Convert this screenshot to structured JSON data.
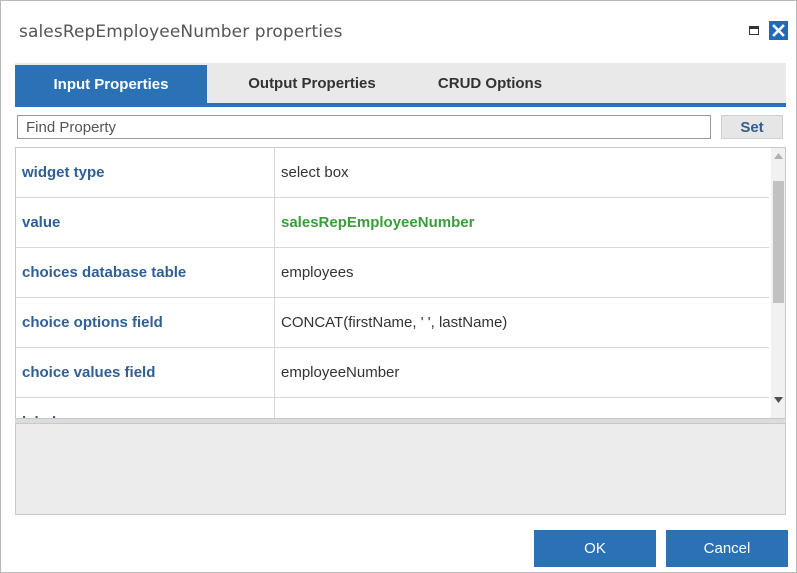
{
  "window": {
    "title": "salesRepEmployeeNumber properties",
    "maximize_icon": "maximize-icon",
    "close_icon": "close-icon"
  },
  "tabs": [
    {
      "label": "Input Properties",
      "active": true
    },
    {
      "label": "Output Properties",
      "active": false
    },
    {
      "label": "CRUD Options",
      "active": false
    }
  ],
  "find": {
    "placeholder": "Find Property",
    "value": "",
    "set_label": "Set"
  },
  "properties": [
    {
      "name": "widget type",
      "value": "select box"
    },
    {
      "name": "value",
      "value": "salesRepEmployeeNumber"
    },
    {
      "name": "choices database table",
      "value": "employees"
    },
    {
      "name": "choice options field",
      "value": "CONCAT(firstName, ' ', lastName)"
    },
    {
      "name": "choice values field",
      "value": "employeeNumber"
    },
    {
      "name": "label ...",
      "value": "..."
    }
  ],
  "colors": {
    "accent": "#2a72b5",
    "property_name": "#2f5f95",
    "highlight_value": "#3a9c3a"
  },
  "footer": {
    "ok_label": "OK",
    "cancel_label": "Cancel"
  }
}
